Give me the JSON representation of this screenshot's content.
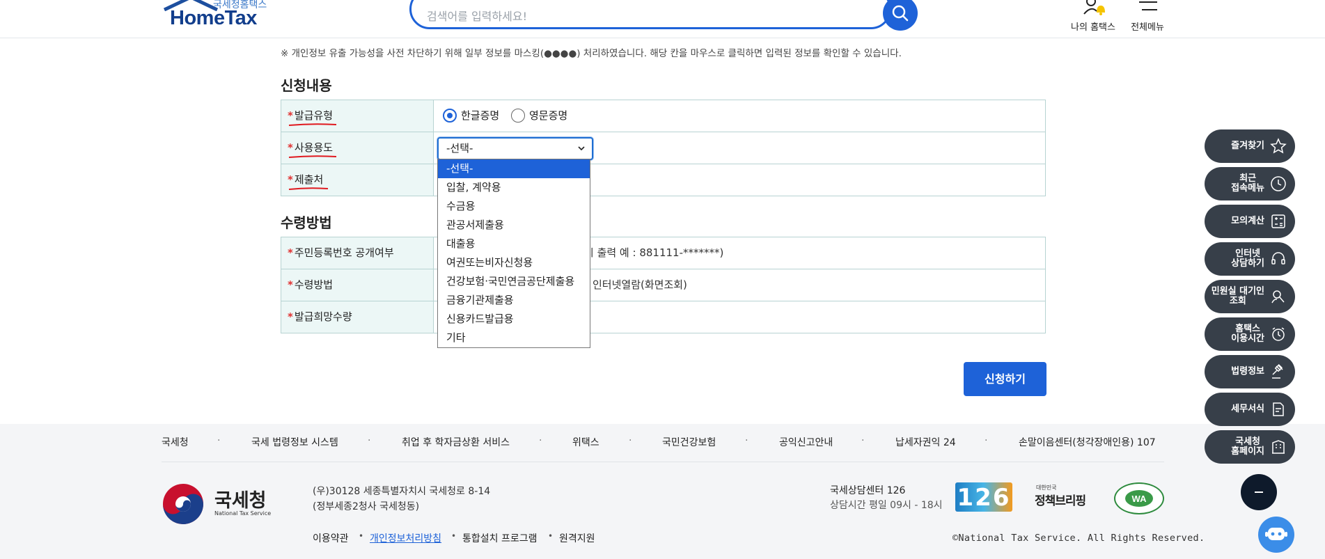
{
  "header": {
    "logo_sub": "국세청홈택스",
    "logo_main": "HomeTax",
    "search_placeholder": "검색어를 입력하세요!",
    "my_hometax": "나의 홈택스",
    "all_menu": "전체메뉴"
  },
  "notice": "※ 개인정보 유출 가능성을 사전 차단하기 위해 일부 정보를 마스킹(●●●●) 처리하였습니다. 해당 칸을 마우스로 클릭하면 입력된 정보를 확인할 수 있습니다.",
  "application": {
    "title": "신청내용",
    "issue_type_label": "발급유형",
    "radio_korean": "한글증명",
    "radio_english": "영문증명",
    "usage_label": "사용용도",
    "usage_selected": "-선택-",
    "submit_to_label": "제출처"
  },
  "dropdown_options": [
    "-선택-",
    "입찰, 계약용",
    "수금용",
    "관공서제출용",
    "대출용",
    "여권또는비자신청용",
    "건강보험·국민연금공단제출용",
    "금융기관제출용",
    "신용카드발급용",
    "기타"
  ],
  "receipt": {
    "title": "수령방법",
    "rrn_label": "주민등록번호 공개여부",
    "rrn_hint": "시 출력 예 : 881111-*******)",
    "method_label": "수령방법",
    "method_value": "인터넷열람(화면조회)",
    "qty_label": "발급희망수량"
  },
  "apply_button": "신청하기",
  "footer": {
    "links": [
      "국세청",
      "국세 법령정보 시스템",
      "취업 후 학자금상환 서비스",
      "위택스",
      "국민건강보험",
      "공익신고안내",
      "납세자권익 24",
      "손말이음센터(청각장애인용) 107"
    ],
    "org_name": "국세청",
    "org_en": "National Tax Service",
    "address_line1": "(우)30128 세종특별자치시 국세청로 8-14",
    "address_line2": "(정부세종2청사 국세청동)",
    "legal": [
      "이용약관",
      "개인정보처리방침",
      "통합설치 프로그램",
      "원격지원"
    ],
    "center_name": "국세상담센터 126",
    "center_hours": "상담시간 평일 09시 - 18시",
    "badge_126": "126",
    "badge_policy_small": "대한민국",
    "badge_policy": "정책브리핑",
    "copyright": "©National Tax Service. All Rights Reserved."
  },
  "side_menu": [
    {
      "label": "즐겨찾기",
      "icon": "star-icon"
    },
    {
      "label": "최근\n접속메뉴",
      "icon": "clock-icon"
    },
    {
      "label": "모의계산",
      "icon": "calculator-icon"
    },
    {
      "label": "인터넷\n상담하기",
      "icon": "headset-icon"
    },
    {
      "label": "민원실 대기인\n조회",
      "icon": "search-person-icon"
    },
    {
      "label": "홈택스\n이용시간",
      "icon": "alarm-icon"
    },
    {
      "label": "법령정보",
      "icon": "gavel-icon"
    },
    {
      "label": "세무서식",
      "icon": "document-icon"
    },
    {
      "label": "국세청\n홈페이지",
      "icon": "building-icon"
    }
  ],
  "colors": {
    "primary": "#1e62d8",
    "header_cell_bg": "#ecf7f6",
    "table_border": "#b7d3d2",
    "side_bg": "#373f49",
    "required": "#e03131",
    "annotation_underline": "#e0191f"
  }
}
